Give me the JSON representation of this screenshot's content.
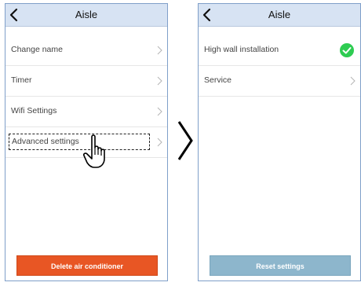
{
  "left_screen": {
    "title": "Aisle",
    "menu_items": [
      {
        "label": "Change name"
      },
      {
        "label": "Timer"
      },
      {
        "label": "Wifi Settings"
      },
      {
        "label": "Advanced settings"
      }
    ],
    "delete_label": "Delete air conditioner",
    "delete_color": "#e85624"
  },
  "right_screen": {
    "title": "Aisle",
    "items": [
      {
        "label": "High wall installation",
        "checked": true
      },
      {
        "label": "Service"
      }
    ],
    "reset_label": "Reset settings",
    "reset_color": "#8db6cc"
  },
  "colors": {
    "header_bg": "#d7e3f3",
    "check_green": "#2ecc52"
  },
  "icons": {
    "back": "back-chevron-icon",
    "row": "chevron-right-icon",
    "transition": "transition-arrow-icon",
    "pointer": "hand-pointer-icon",
    "check": "check-circle-icon"
  }
}
